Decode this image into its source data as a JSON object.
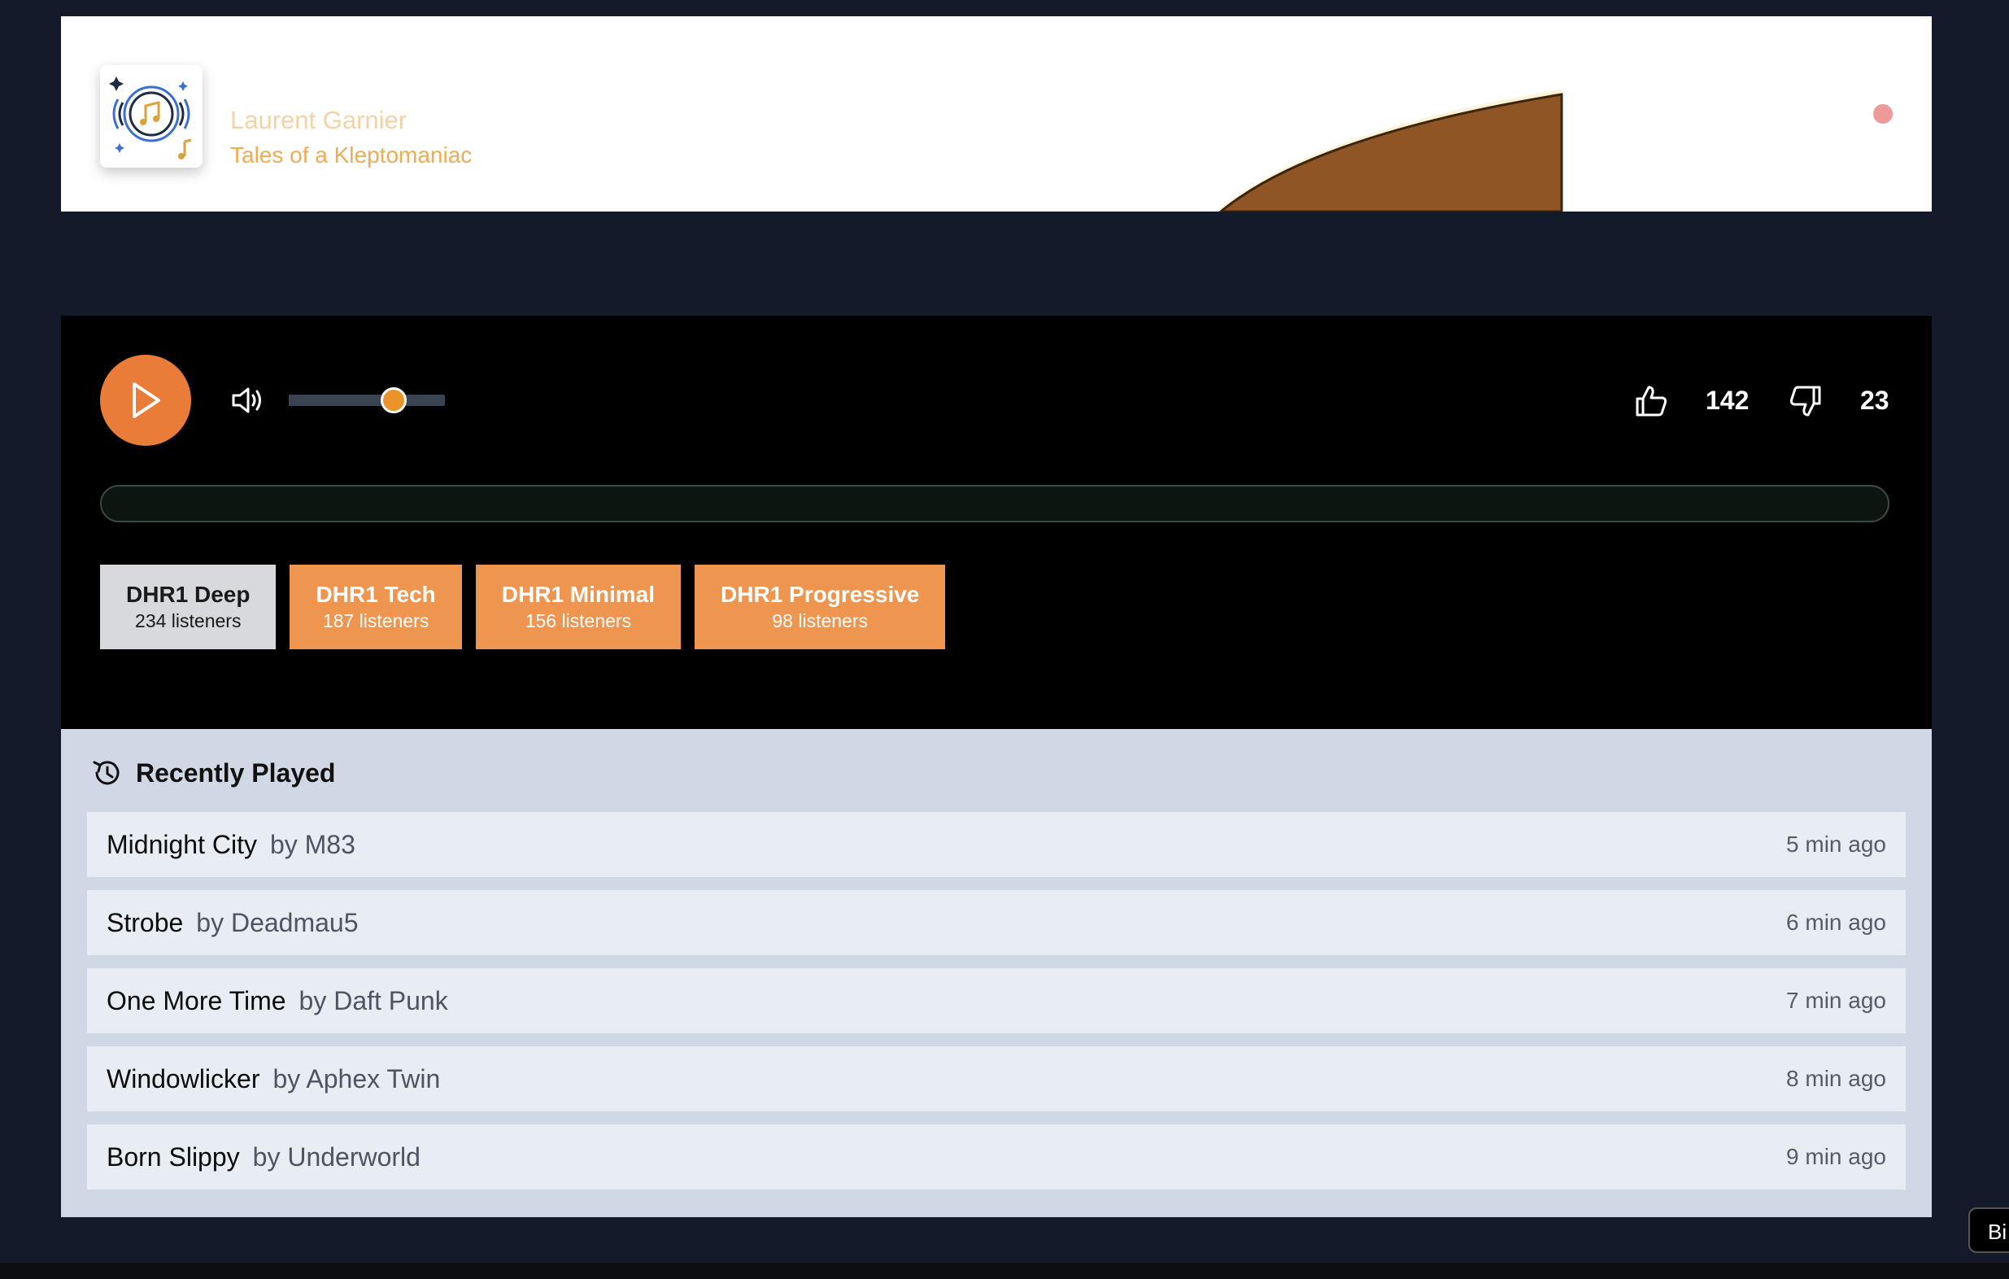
{
  "now_playing": {
    "artist": "Laurent Garnier",
    "track": "Tales of a Kleptomaniac"
  },
  "controls": {
    "volume_level": 0.67,
    "track_progress": 0.0,
    "likes": "142",
    "dislikes": "23"
  },
  "stations": [
    {
      "name": "DHR1 Deep",
      "listeners": "234 listeners",
      "active": true
    },
    {
      "name": "DHR1 Tech",
      "listeners": "187 listeners",
      "active": false
    },
    {
      "name": "DHR1 Minimal",
      "listeners": "156 listeners",
      "active": false
    },
    {
      "name": "DHR1 Progressive",
      "listeners": "98 listeners",
      "active": false
    }
  ],
  "recently_played": {
    "title": "Recently Played",
    "items": [
      {
        "title": "Midnight City",
        "artist": "by M83",
        "ago": "5 min ago"
      },
      {
        "title": "Strobe",
        "artist": "by Deadmau5",
        "ago": "6 min ago"
      },
      {
        "title": "One More Time",
        "artist": "by Daft Punk",
        "ago": "7 min ago"
      },
      {
        "title": "Windowlicker",
        "artist": "by Aphex Twin",
        "ago": "8 min ago"
      },
      {
        "title": "Born Slippy",
        "artist": "by Underworld",
        "ago": "9 min ago"
      }
    ]
  },
  "tooltip": "Bi",
  "colors": {
    "accent": "#e97c38",
    "station_inactive": "#ee9550",
    "station_active": "#d8d9dc",
    "page_bg": "#141a29",
    "recent_bg": "#d1d8e5"
  }
}
